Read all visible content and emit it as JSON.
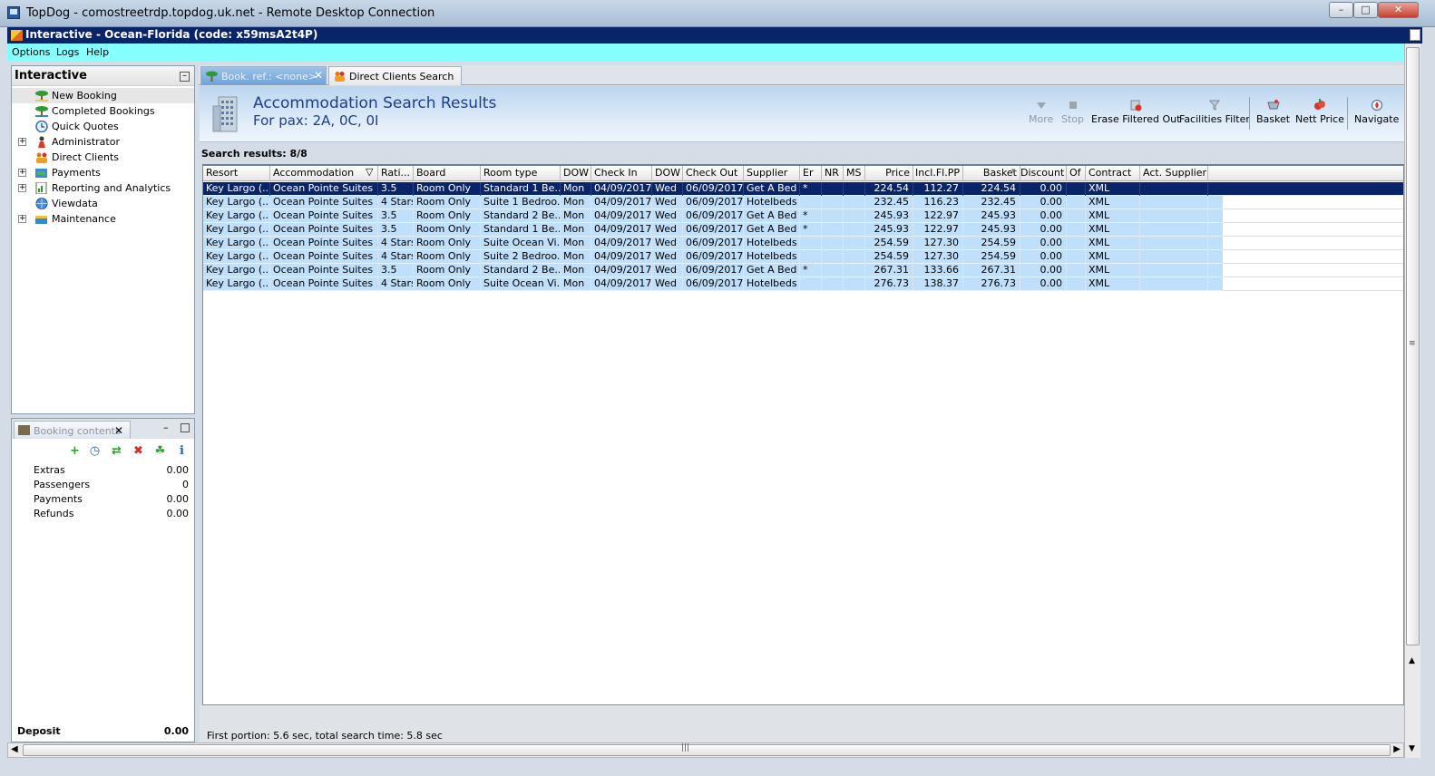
{
  "rdp_window": {
    "title": "TopDog - comostreetrdp.topdog.uk.net - Remote Desktop Connection"
  },
  "app_window": {
    "title": "Interactive - Ocean-Florida (code: x59msA2t4P)"
  },
  "menu": [
    "Options",
    "Logs",
    "Help"
  ],
  "left_panel": {
    "title": "Interactive",
    "items": [
      {
        "label": "New Booking",
        "icon": "palm-tree-icon",
        "expandable": false,
        "selected": true
      },
      {
        "label": "Completed Bookings",
        "icon": "palm-tree-icon",
        "expandable": false,
        "selected": false
      },
      {
        "label": "Quick Quotes",
        "icon": "clock-icon",
        "expandable": false,
        "selected": false
      },
      {
        "label": "Administrator",
        "icon": "person-icon",
        "expandable": true,
        "selected": false
      },
      {
        "label": "Direct Clients",
        "icon": "people-icon",
        "expandable": false,
        "selected": false
      },
      {
        "label": "Payments",
        "icon": "payment-icon",
        "expandable": true,
        "selected": false
      },
      {
        "label": "Reporting and Analytics",
        "icon": "report-icon",
        "expandable": true,
        "selected": false
      },
      {
        "label": "Viewdata",
        "icon": "globe-icon",
        "expandable": false,
        "selected": false
      },
      {
        "label": "Maintenance",
        "icon": "maintenance-icon",
        "expandable": true,
        "selected": false
      }
    ]
  },
  "booking_contents": {
    "tab_label": "Booking contents",
    "rows": [
      {
        "label": "Extras",
        "value": "0.00"
      },
      {
        "label": "Passengers",
        "value": "0"
      },
      {
        "label": "Payments",
        "value": "0.00"
      },
      {
        "label": "Refunds",
        "value": "0.00"
      }
    ],
    "deposit_label": "Deposit",
    "deposit_value": "0.00"
  },
  "tabs": [
    {
      "label": "Book. ref.: <none>",
      "icon": "palm-tree-icon",
      "active": true,
      "closable": true
    },
    {
      "label": "Direct Clients Search",
      "icon": "people-icon",
      "active": false,
      "closable": false
    }
  ],
  "results": {
    "title": "Accommodation Search Results",
    "pax": "For pax: 2A, 0C, 0I",
    "count_label": "Search results: 8/8",
    "toolbar": {
      "more": "More",
      "stop": "Stop",
      "erase": "Erase Filtered Out",
      "facilities": "Facilities Filter",
      "basket": "Basket",
      "nett_price": "Nett Price",
      "navigate": "Navigate"
    },
    "columns": [
      "Resort",
      "Accommodation",
      "Rati...",
      "Board",
      "Room type",
      "DOW",
      "Check In",
      "DOW",
      "Check Out",
      "Supplier",
      "Er",
      "NR",
      "MS",
      "Price",
      "Incl.Fl.PP",
      "Basket",
      "Discount",
      "Of",
      "Contract",
      "Act. Supplier"
    ],
    "rows": [
      [
        "Key Largo (...",
        "Ocean Pointe Suites",
        "3.5",
        "Room Only",
        "Standard 1 Be...",
        "Mon",
        "04/09/2017",
        "Wed",
        "06/09/2017",
        "Get A Bed",
        "*",
        "",
        "",
        "224.54",
        "112.27",
        "224.54",
        "0.00",
        "",
        "XML",
        ""
      ],
      [
        "Key Largo (...",
        "Ocean Pointe Suites ...",
        "4 Stars",
        "Room Only",
        "Suite 1 Bedroo...",
        "Mon",
        "04/09/2017",
        "Wed",
        "06/09/2017",
        "Hotelbeds",
        "",
        "",
        "",
        "232.45",
        "116.23",
        "232.45",
        "0.00",
        "",
        "XML",
        ""
      ],
      [
        "Key Largo (...",
        "Ocean Pointe Suites",
        "3.5",
        "Room Only",
        "Standard 2 Be...",
        "Mon",
        "04/09/2017",
        "Wed",
        "06/09/2017",
        "Get A Bed",
        "*",
        "",
        "",
        "245.93",
        "122.97",
        "245.93",
        "0.00",
        "",
        "XML",
        ""
      ],
      [
        "Key Largo (...",
        "Ocean Pointe Suites",
        "3.5",
        "Room Only",
        "Standard 1 Be...",
        "Mon",
        "04/09/2017",
        "Wed",
        "06/09/2017",
        "Get A Bed",
        "*",
        "",
        "",
        "245.93",
        "122.97",
        "245.93",
        "0.00",
        "",
        "XML",
        ""
      ],
      [
        "Key Largo (...",
        "Ocean Pointe Suites ...",
        "4 Stars",
        "Room Only",
        "Suite Ocean Vi...",
        "Mon",
        "04/09/2017",
        "Wed",
        "06/09/2017",
        "Hotelbeds",
        "",
        "",
        "",
        "254.59",
        "127.30",
        "254.59",
        "0.00",
        "",
        "XML",
        ""
      ],
      [
        "Key Largo (...",
        "Ocean Pointe Suites ...",
        "4 Stars",
        "Room Only",
        "Suite 2 Bedroo...",
        "Mon",
        "04/09/2017",
        "Wed",
        "06/09/2017",
        "Hotelbeds",
        "",
        "",
        "",
        "254.59",
        "127.30",
        "254.59",
        "0.00",
        "",
        "XML",
        ""
      ],
      [
        "Key Largo (...",
        "Ocean Pointe Suites",
        "3.5",
        "Room Only",
        "Standard 2 Be...",
        "Mon",
        "04/09/2017",
        "Wed",
        "06/09/2017",
        "Get A Bed",
        "*",
        "",
        "",
        "267.31",
        "133.66",
        "267.31",
        "0.00",
        "",
        "XML",
        ""
      ],
      [
        "Key Largo (...",
        "Ocean Pointe Suites ...",
        "4 Stars",
        "Room Only",
        "Suite Ocean Vi...",
        "Mon",
        "04/09/2017",
        "Wed",
        "06/09/2017",
        "Hotelbeds",
        "",
        "",
        "",
        "276.73",
        "138.37",
        "276.73",
        "0.00",
        "",
        "XML",
        ""
      ]
    ],
    "status": "First portion: 5.6 sec, total search time: 5.8 sec"
  },
  "colors": {
    "selected_row": "#0a246a",
    "row_background": "#bfdffa",
    "menu_bar": "#86ffff",
    "title_text": "#1d3e8a"
  }
}
